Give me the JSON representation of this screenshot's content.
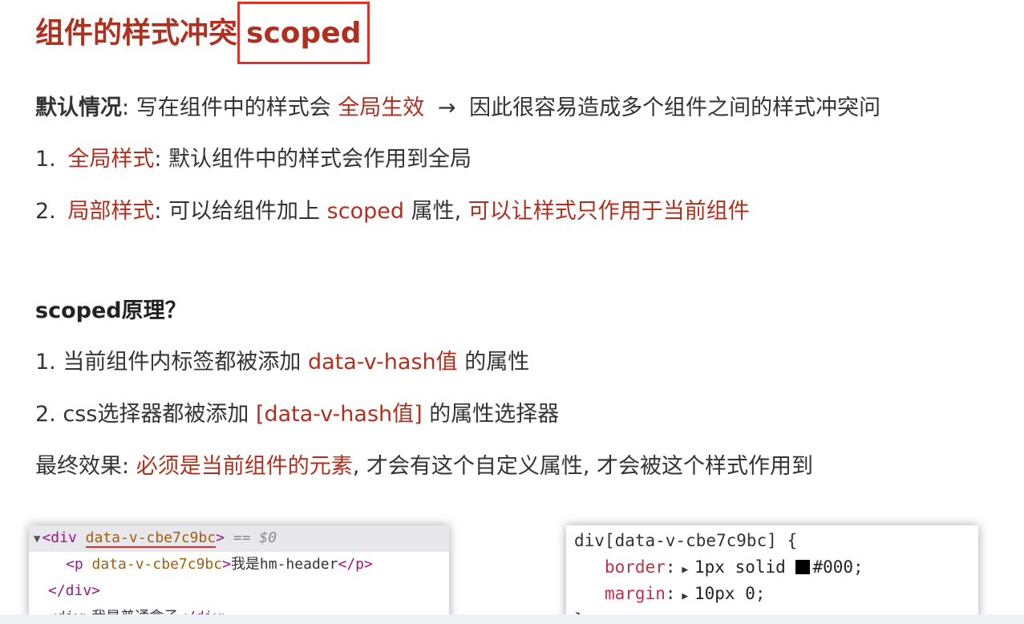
{
  "title": {
    "text": "组件的样式冲突",
    "highlight": "scoped"
  },
  "intro": {
    "label": "默认情况",
    "colon": ":",
    "text1": "写在组件中的样式会",
    "highlight": "全局生效",
    "arrow": "→",
    "text2": "因此很容易造成多个组件之间的样式冲突问"
  },
  "list1": [
    {
      "num": "1.",
      "term": "全局样式",
      "colon": ":",
      "desc": "默认组件中的样式会作用到全局"
    },
    {
      "num": "2.",
      "term": "局部样式",
      "colon": ":",
      "desc_pre": "可以给组件加上",
      "code": "scoped",
      "desc_mid": "属性,",
      "desc_hl": "可以让样式只作用于当前组件"
    }
  ],
  "principle": {
    "heading": "scoped原理？",
    "items": [
      {
        "num": "1.",
        "pre": "当前组件内标签都被添加",
        "hl": "data-v-hash值",
        "post": "的属性"
      },
      {
        "num": "2.",
        "pre": "css选择器都被添加",
        "hl": "[data-v-hash值]",
        "post": "的属性选择器"
      }
    ],
    "final_label": "最终效果:",
    "final_hl": "必须是当前组件的元素",
    "final_rest": ", 才会有这个自定义属性, 才会被这个样式作用到"
  },
  "dom_panel": {
    "rows": [
      {
        "open": "<div",
        "attr": "data-v-cbe7c9bc",
        "close": ">",
        "meta": "== $0"
      },
      {
        "open": "<p",
        "attr": "data-v-cbe7c9bc",
        "close": ">",
        "text": "我是hm-header",
        "end": "</p>"
      },
      {
        "end": "</div>"
      },
      {
        "open": "<div>",
        "text": "我是普通盒子",
        "end": "</div>"
      }
    ]
  },
  "css_panel": {
    "selector": "div[data-v-cbe7c9bc] {",
    "decls": [
      {
        "prop": "border",
        "value_pre": "1px solid ",
        "value_color": "#000",
        "swatch": "#000000",
        "semicolon": ";"
      },
      {
        "prop": "margin",
        "value_pre": "10px 0",
        "semicolon": ";"
      }
    ],
    "close": "}"
  },
  "colors": {
    "accent": "#b03020",
    "box": "#d8342a",
    "text": "#333333"
  }
}
